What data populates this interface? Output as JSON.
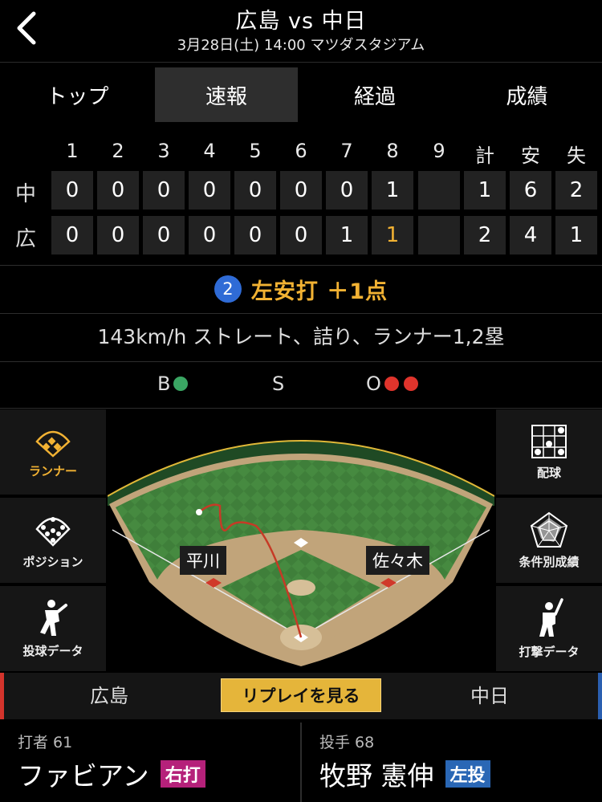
{
  "header": {
    "title": "広島 vs 中日",
    "subtitle": "3月28日(土) 14:00 マツダスタジアム",
    "back_icon": "chevron-left-icon"
  },
  "tabs": [
    {
      "label": "トップ",
      "active": false
    },
    {
      "label": "速報",
      "active": true
    },
    {
      "label": "経過",
      "active": false
    },
    {
      "label": "成績",
      "active": false
    }
  ],
  "scoreboard": {
    "headers": [
      "1",
      "2",
      "3",
      "4",
      "5",
      "6",
      "7",
      "8",
      "9",
      "計",
      "安",
      "失"
    ],
    "rows": [
      {
        "team": "中",
        "innings": [
          "0",
          "0",
          "0",
          "0",
          "0",
          "0",
          "0",
          "1",
          ""
        ],
        "totals": [
          "1",
          "6",
          "2"
        ]
      },
      {
        "team": "広",
        "innings": [
          "0",
          "0",
          "0",
          "0",
          "0",
          "0",
          "1",
          "1",
          ""
        ],
        "totals": [
          "2",
          "4",
          "1"
        ]
      }
    ],
    "highlight_color": "#f2b233"
  },
  "play": {
    "badge": "2",
    "text": "左安打 ＋1点",
    "description": "143km/h ストレート、詰り、ランナー1,2塁"
  },
  "count": {
    "balls_label": "B",
    "strikes_label": "S",
    "outs_label": "O",
    "balls": 1,
    "strikes": 0,
    "outs": 2,
    "ball_color": "#3aa663",
    "out_color": "#e0342c"
  },
  "side_left": [
    {
      "label": "ランナー",
      "icon": "diamond-runner-icon",
      "active": true
    },
    {
      "label": "ポジション",
      "icon": "position-icon",
      "active": false
    },
    {
      "label": "投球データ",
      "icon": "pitcher-icon",
      "active": false
    }
  ],
  "side_right": [
    {
      "label": "配球",
      "icon": "pitch-grid-icon",
      "active": false
    },
    {
      "label": "条件別成績",
      "icon": "radar-chart-icon",
      "active": false
    },
    {
      "label": "打撃データ",
      "icon": "batter-icon",
      "active": false
    }
  ],
  "field": {
    "runner_left": "平川",
    "runner_right": "佐々木"
  },
  "bottom_bar": {
    "home_team": "広島",
    "replay_label": "リプレイを見る",
    "away_team": "中日"
  },
  "batter": {
    "role": "打者 61",
    "name": "ファビアン",
    "tag": "右打",
    "tag_color": "#b5217a"
  },
  "pitcher": {
    "role": "投手 68",
    "name": "牧野 憲伸",
    "tag": "左投",
    "tag_color": "#2a67b5"
  }
}
